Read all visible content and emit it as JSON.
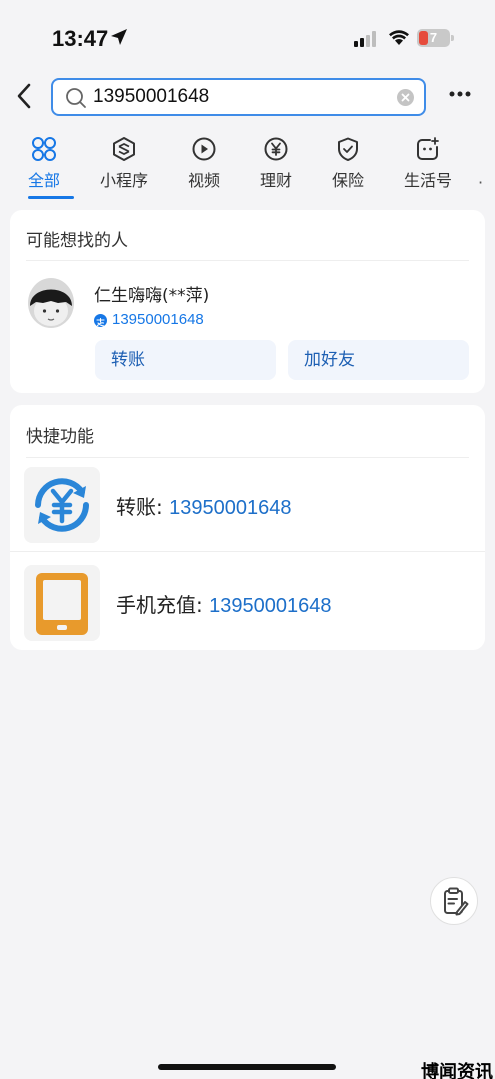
{
  "status_bar": {
    "time": "13:47",
    "battery_level": "7"
  },
  "search": {
    "value": "13950001648"
  },
  "tabs": [
    {
      "label": "全部",
      "icon": "grid-icon",
      "active": true
    },
    {
      "label": "小程序",
      "icon": "mini-program-icon"
    },
    {
      "label": "视频",
      "icon": "video-play-icon"
    },
    {
      "label": "理财",
      "icon": "yuan-icon"
    },
    {
      "label": "保险",
      "icon": "shield-icon"
    },
    {
      "label": "生活号",
      "icon": "life-account-icon"
    }
  ],
  "people_card": {
    "title": "可能想找的人",
    "name": "仁生嗨嗨(**萍)",
    "phone": "13950001648",
    "transfer_label": "转账",
    "add_friend_label": "加好友"
  },
  "shortcuts_card": {
    "title": "快捷功能",
    "items": [
      {
        "label": "转账: ",
        "value": "13950001648",
        "icon": "transfer-yuan-icon",
        "color": "#2a86d8"
      },
      {
        "label": "手机充值: ",
        "value": "13950001648",
        "icon": "phone-topup-icon",
        "color": "#e89a2c"
      }
    ]
  },
  "watermark": "博闻资讯",
  "colors": {
    "accent": "#1677e6",
    "background": "#f4f4f6"
  }
}
